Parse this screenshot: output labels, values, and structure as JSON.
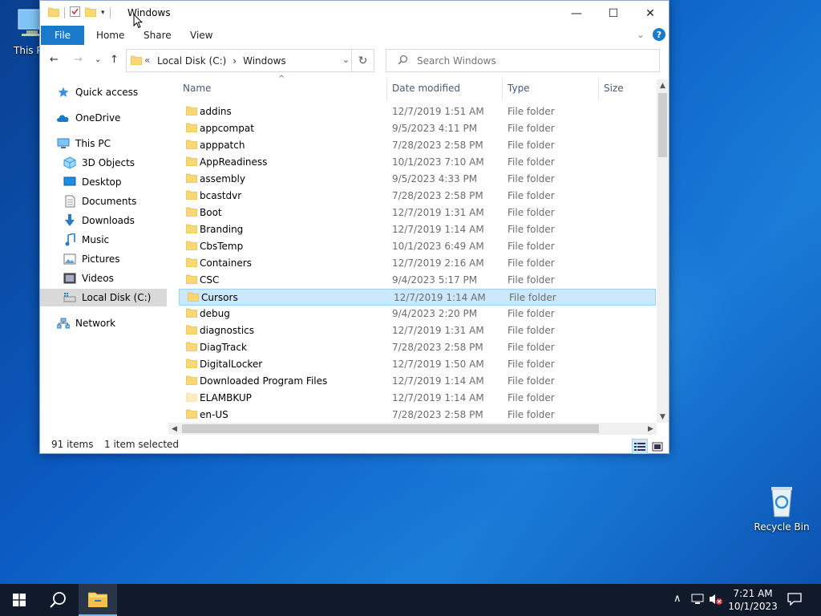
{
  "desktop": {
    "icons": [
      {
        "label": "This PC"
      },
      {
        "label": "Recycle Bin"
      }
    ]
  },
  "window": {
    "title": "Windows",
    "controls": {
      "minimize": "—",
      "maximize": "☐",
      "close": "✕"
    },
    "ribbon": {
      "file": "File",
      "tabs": [
        "Home",
        "Share",
        "View"
      ],
      "expand_glyph": "⌄",
      "help": "?"
    },
    "nav": {
      "back": "←",
      "forward": "→",
      "recent": "⌄",
      "up": "↑",
      "address": {
        "overflow": "«",
        "crumbs": [
          "Local Disk (C:)",
          "Windows"
        ],
        "separator": "›",
        "dropdown": "⌄",
        "refresh": "↻"
      },
      "search_placeholder": "Search Windows"
    },
    "navpane": [
      {
        "label": "Quick access",
        "icon": "star-icon",
        "level": 0
      },
      {
        "label": "OneDrive",
        "icon": "cloud-icon",
        "level": 0
      },
      {
        "label": "This PC",
        "icon": "computer-icon",
        "level": 0
      },
      {
        "label": "3D Objects",
        "icon": "cube-icon",
        "level": 1
      },
      {
        "label": "Desktop",
        "icon": "desktop-icon",
        "level": 1
      },
      {
        "label": "Documents",
        "icon": "document-icon",
        "level": 1
      },
      {
        "label": "Downloads",
        "icon": "download-icon",
        "level": 1
      },
      {
        "label": "Music",
        "icon": "music-icon",
        "level": 1
      },
      {
        "label": "Pictures",
        "icon": "picture-icon",
        "level": 1
      },
      {
        "label": "Videos",
        "icon": "video-icon",
        "level": 1
      },
      {
        "label": "Local Disk (C:)",
        "icon": "drive-icon",
        "level": 1,
        "selected": true
      },
      {
        "label": "Network",
        "icon": "network-icon",
        "level": 0
      }
    ],
    "columns": [
      "Name",
      "Date modified",
      "Type",
      "Size"
    ],
    "sort_glyph": "^",
    "files": [
      {
        "name": "addins",
        "date": "12/7/2019 1:51 AM",
        "type": "File folder"
      },
      {
        "name": "appcompat",
        "date": "9/5/2023 4:11 PM",
        "type": "File folder"
      },
      {
        "name": "apppatch",
        "date": "7/28/2023 2:58 PM",
        "type": "File folder"
      },
      {
        "name": "AppReadiness",
        "date": "10/1/2023 7:10 AM",
        "type": "File folder"
      },
      {
        "name": "assembly",
        "date": "9/5/2023 4:33 PM",
        "type": "File folder"
      },
      {
        "name": "bcastdvr",
        "date": "7/28/2023 2:58 PM",
        "type": "File folder"
      },
      {
        "name": "Boot",
        "date": "12/7/2019 1:31 AM",
        "type": "File folder"
      },
      {
        "name": "Branding",
        "date": "12/7/2019 1:14 AM",
        "type": "File folder"
      },
      {
        "name": "CbsTemp",
        "date": "10/1/2023 6:49 AM",
        "type": "File folder"
      },
      {
        "name": "Containers",
        "date": "12/7/2019 2:16 AM",
        "type": "File folder"
      },
      {
        "name": "CSC",
        "date": "9/4/2023 5:17 PM",
        "type": "File folder"
      },
      {
        "name": "Cursors",
        "date": "12/7/2019 1:14 AM",
        "type": "File folder",
        "selected": true
      },
      {
        "name": "debug",
        "date": "9/4/2023 2:20 PM",
        "type": "File folder"
      },
      {
        "name": "diagnostics",
        "date": "12/7/2019 1:31 AM",
        "type": "File folder"
      },
      {
        "name": "DiagTrack",
        "date": "7/28/2023 2:58 PM",
        "type": "File folder"
      },
      {
        "name": "DigitalLocker",
        "date": "12/7/2019 1:50 AM",
        "type": "File folder"
      },
      {
        "name": "Downloaded Program Files",
        "date": "12/7/2019 1:14 AM",
        "type": "File folder"
      },
      {
        "name": "ELAMBKUP",
        "date": "12/7/2019 1:14 AM",
        "type": "File folder",
        "faded": true
      },
      {
        "name": "en-US",
        "date": "7/28/2023 2:58 PM",
        "type": "File folder"
      }
    ],
    "status": {
      "items": "91 items",
      "selected": "1 item selected"
    }
  },
  "taskbar": {
    "time": "7:21 AM",
    "date": "10/1/2023",
    "tray_chevron": "∧"
  },
  "colors": {
    "accent": "#1979ca",
    "selection": "#cce8ff",
    "folder": "#f8d775",
    "taskbar": "#101a2a"
  }
}
